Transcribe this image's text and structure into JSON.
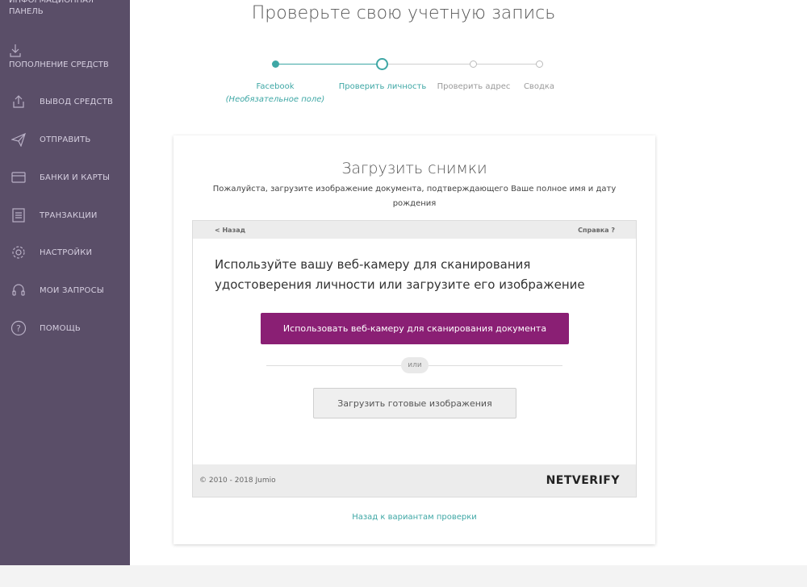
{
  "sidebar": {
    "top_item": "ИНФОРМАЦИОННАЯ ПАНЕЛЬ",
    "deposit": "ПОПОЛНЕНИЕ СРЕДСТВ",
    "items": [
      {
        "label": "ВЫВОД СРЕДСТВ",
        "icon": "upload-icon"
      },
      {
        "label": "ОТПРАВИТЬ",
        "icon": "paper-plane-icon"
      },
      {
        "label": "БАНКИ И КАРТЫ",
        "icon": "card-icon"
      },
      {
        "label": "ТРАНЗАКЦИИ",
        "icon": "list-icon"
      },
      {
        "label": "НАСТРОЙКИ",
        "icon": "gear-icon"
      },
      {
        "label": "МОИ ЗАПРОСЫ",
        "icon": "headset-icon"
      },
      {
        "label": "ПОМОЩЬ",
        "icon": "question-icon"
      }
    ]
  },
  "page": {
    "title": "Проверьте свою учетную запись"
  },
  "stepper": {
    "steps": [
      {
        "label": "Facebook",
        "sub": "(Необязательное поле)",
        "state": "done"
      },
      {
        "label": "Проверить личность",
        "state": "current"
      },
      {
        "label": "Проверить адрес",
        "state": "pending"
      },
      {
        "label": "Сводка",
        "state": "pending"
      }
    ]
  },
  "card": {
    "title": "Загрузить снимки",
    "subtitle": "Пожалуйста, загрузите изображение документа, подтверждающего Ваше полное имя и дату рождения",
    "frame": {
      "back": "< Назад",
      "help": "Справка ?",
      "text": "Используйте вашу веб-камеру для сканирования удостоверения личности или загрузите его изображение",
      "webcam_button": "Использовать веб-камеру для сканирования документа",
      "or": "или",
      "upload_button": "Загрузить готовые изображения",
      "copyright": "© 2010 - 2018 Jumio",
      "brand": "NETVERIFY"
    },
    "back_link": "Назад к вариантам проверки"
  },
  "colors": {
    "sidebar_bg": "#5a4e68",
    "accent_teal": "#3ea7a5",
    "primary_button": "#8a1f74"
  }
}
